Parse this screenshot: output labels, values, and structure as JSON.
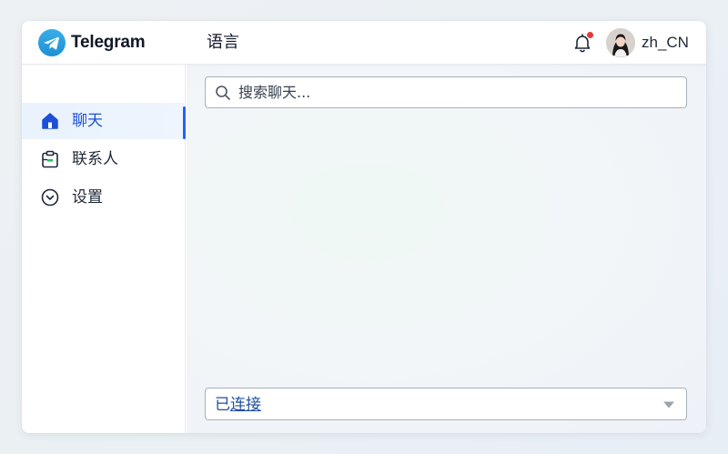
{
  "app": {
    "name": "Telegram",
    "page_title": "语言"
  },
  "header": {
    "username": "zh_CN",
    "notification_dot": true
  },
  "sidebar": {
    "items": [
      {
        "label": "聊天",
        "icon": "home-icon",
        "active": true
      },
      {
        "label": "联系人",
        "icon": "clipboard-icon",
        "active": false
      },
      {
        "label": "设置",
        "icon": "chevron-circle-icon",
        "active": false
      }
    ]
  },
  "search": {
    "placeholder": "搜索聊天..."
  },
  "status": {
    "prefix": "已",
    "link": "连接"
  },
  "colors": {
    "accent": "#2563eb",
    "brand": "#2aa3e6",
    "alert": "#e53935"
  }
}
